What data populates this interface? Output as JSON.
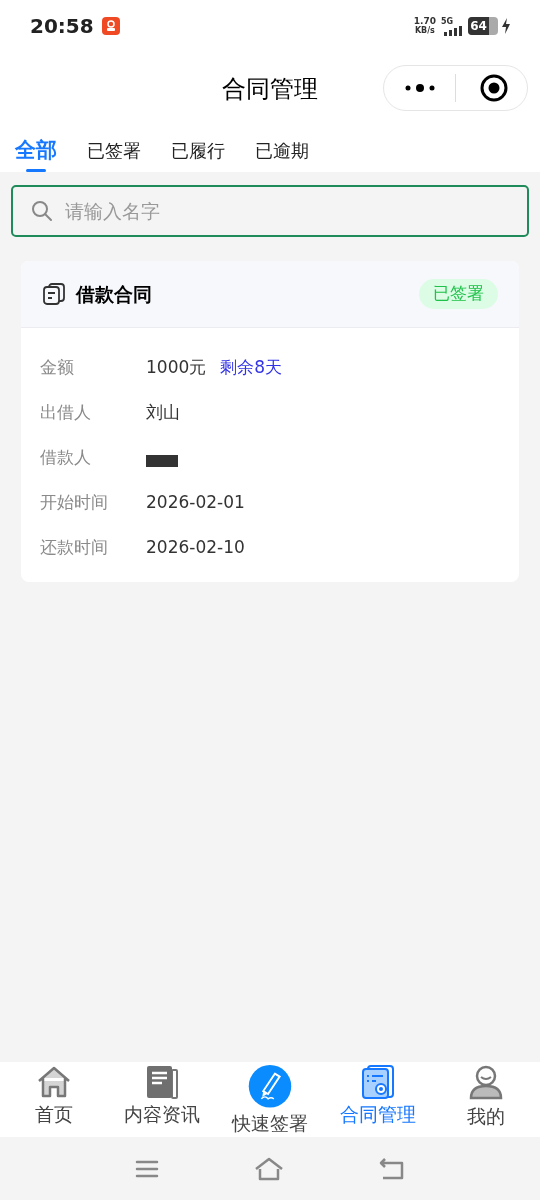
{
  "status_bar": {
    "time": "20:58",
    "net_speed": "1.70",
    "net_unit": "KB/s",
    "network": "5G",
    "battery": "64"
  },
  "header": {
    "title": "合同管理"
  },
  "tabs": [
    {
      "label": "全部",
      "selected": true
    },
    {
      "label": "已签署",
      "selected": false
    },
    {
      "label": "已履行",
      "selected": false
    },
    {
      "label": "已逾期",
      "selected": false
    }
  ],
  "search": {
    "placeholder": "请输入名字"
  },
  "contracts": [
    {
      "title": "借款合同",
      "status": "已签署",
      "fields": [
        {
          "label": "金额",
          "value": "1000元",
          "note": "剩余8天"
        },
        {
          "label": "出借人",
          "value": "刘山"
        },
        {
          "label": "借款人",
          "redacted": true
        },
        {
          "label": "开始时间",
          "value": "2026-02-01"
        },
        {
          "label": "还款时间",
          "value": "2026-02-10"
        }
      ]
    }
  ],
  "bottom_nav": [
    {
      "kind": "home",
      "label": "首页",
      "selected": false
    },
    {
      "kind": "news",
      "label": "内容资讯",
      "selected": false
    },
    {
      "kind": "sign",
      "label": "快速签署",
      "selected": false
    },
    {
      "kind": "contract",
      "label": "合同管理",
      "selected": true
    },
    {
      "kind": "profile",
      "label": "我的",
      "selected": false
    }
  ]
}
